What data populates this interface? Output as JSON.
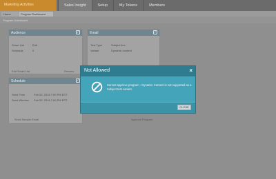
{
  "topbar": {
    "brand": "Marketing Activities",
    "nav": [
      {
        "label": "Sales Insight",
        "active": true
      },
      {
        "label": "Setup",
        "active": false
      },
      {
        "label": "My Tokens",
        "active": false
      },
      {
        "label": "Members",
        "active": false
      }
    ]
  },
  "tabs": {
    "home": "Home",
    "program": "Program Dashboard"
  },
  "breadcrumb": "Program Dashboard",
  "cards": {
    "audience": {
      "title": "Audience",
      "rows": [
        {
          "label": "Smart List",
          "value": "Edit"
        },
        {
          "label": "Schedule",
          "value": "0"
        }
      ],
      "footer_left": "Edit Smart List",
      "footer_right": "Preview"
    },
    "email": {
      "title": "Email",
      "rows": [
        {
          "label": "Test Type",
          "value": "Subject line"
        },
        {
          "label": "Variant",
          "value": "Dynamic content"
        }
      ]
    },
    "schedule": {
      "title": "Schedule",
      "rows": [
        {
          "label": "Send Time",
          "value": "Feb 02, 2016 7:00 PM EST"
        },
        {
          "label": "Send Window",
          "value": "Feb 02, 2016 7:00 PM EST"
        }
      ],
      "footer": "Send Sample Email"
    },
    "approve": {
      "label": "Approve Program"
    }
  },
  "modal": {
    "title": "Not Allowed",
    "close_glyph": "×",
    "message": "Cannot approve program - Dynamic Content is not supported as a Subject test variant.",
    "close_button": "CLOSE"
  }
}
